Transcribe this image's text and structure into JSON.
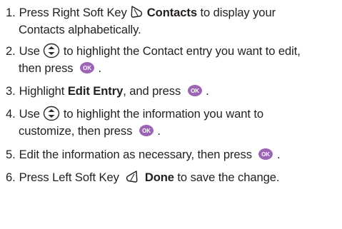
{
  "colors": {
    "text": "#231f20",
    "ok_button": "#9c64b4",
    "ok_button_text": "#ffffff",
    "nav_key_stroke": "#2a2a2a"
  },
  "icons": {
    "right_soft_key": "right-soft-key-icon",
    "nav_key": "nav-key-up-down-icon",
    "ok_key": "ok-key-icon",
    "left_soft_key": "left-soft-key-icon"
  },
  "ok_label": "OK",
  "steps": [
    {
      "num": "1.",
      "a": "Press Right Soft Key",
      "bold": "Contacts",
      "b": "to display your",
      "c": "Contacts alphabetically."
    },
    {
      "num": "2.",
      "a": "Use",
      "b": "to highlight the Contact entry you want to edit,",
      "c": "then press",
      "d": "."
    },
    {
      "num": "3.",
      "a": "Highlight",
      "bold": "Edit Entry",
      "b": ", and press",
      "c": "."
    },
    {
      "num": "4.",
      "a": "Use",
      "b": "to highlight the information you want to",
      "c": "customize, then press",
      "d": "."
    },
    {
      "num": "5.",
      "a": "Edit the information as necessary, then press",
      "b": "."
    },
    {
      "num": "6.",
      "a": "Press Left Soft Key",
      "bold": "Done",
      "b": "to save the change."
    }
  ]
}
